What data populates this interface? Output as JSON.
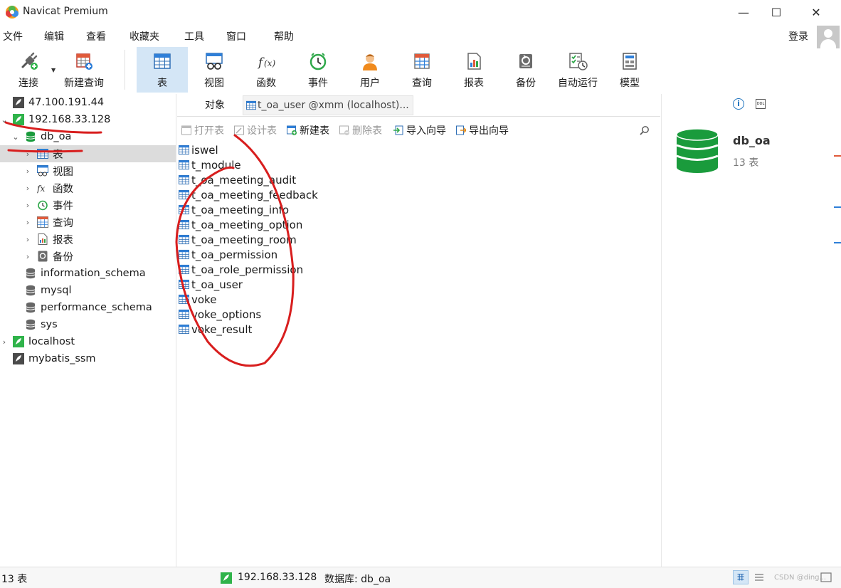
{
  "window": {
    "title": "Navicat Premium",
    "minimize_glyph": "—",
    "maximize_glyph": "☐",
    "close_glyph": "✕"
  },
  "menu": [
    "文件",
    "编辑",
    "查看",
    "收藏夹",
    "工具",
    "窗口",
    "帮助"
  ],
  "account": {
    "login_label": "登录",
    "avatar_icon": "user-avatar-icon"
  },
  "toolbar": [
    {
      "label": "连接",
      "icon": "plug-icon"
    },
    {
      "label": "新建查询",
      "icon": "new-query-icon"
    },
    {
      "label": "表",
      "icon": "table-icon",
      "active": true
    },
    {
      "label": "视图",
      "icon": "view-icon"
    },
    {
      "label": "函数",
      "icon": "function-icon"
    },
    {
      "label": "事件",
      "icon": "clock-icon"
    },
    {
      "label": "用户",
      "icon": "user-icon"
    },
    {
      "label": "查询",
      "icon": "query-icon"
    },
    {
      "label": "报表",
      "icon": "report-icon"
    },
    {
      "label": "备份",
      "icon": "backup-icon"
    },
    {
      "label": "自动运行",
      "icon": "automation-icon"
    },
    {
      "label": "模型",
      "icon": "model-icon"
    }
  ],
  "nav": {
    "items": [
      {
        "label": "47.100.191.44",
        "kind": "connection"
      },
      {
        "label": "192.168.33.128",
        "kind": "connection",
        "chevron": "⌄"
      },
      {
        "label": "db_oa",
        "kind": "database",
        "chevron": "⌄"
      },
      {
        "label": "表",
        "kind": "tables",
        "chevron": "›"
      },
      {
        "label": "视图",
        "kind": "views",
        "chevron": "›"
      },
      {
        "label": "函数",
        "kind": "functions",
        "chevron": "›"
      },
      {
        "label": "事件",
        "kind": "events",
        "chevron": "›"
      },
      {
        "label": "查询",
        "kind": "queries",
        "chevron": "›"
      },
      {
        "label": "报表",
        "kind": "reports",
        "chevron": "›"
      },
      {
        "label": "备份",
        "kind": "backups",
        "chevron": "›"
      },
      {
        "label": "information_schema",
        "kind": "database"
      },
      {
        "label": "mysql",
        "kind": "database"
      },
      {
        "label": "performance_schema",
        "kind": "database"
      },
      {
        "label": "sys",
        "kind": "database"
      },
      {
        "label": "localhost",
        "kind": "connection",
        "chevron": "›"
      },
      {
        "label": "mybatis_ssm",
        "kind": "connection"
      }
    ]
  },
  "tabs": {
    "objects_label": "对象",
    "query_tab_label": "t_oa_user @xmm (localhost)..."
  },
  "actions": [
    {
      "label": "打开表",
      "icon": "open-table-icon",
      "enabled": false
    },
    {
      "label": "设计表",
      "icon": "design-table-icon",
      "enabled": false
    },
    {
      "label": "新建表",
      "icon": "new-table-icon",
      "enabled": true
    },
    {
      "label": "删除表",
      "icon": "delete-table-icon",
      "enabled": false
    },
    {
      "label": "导入向导",
      "icon": "import-wizard-icon",
      "enabled": true
    },
    {
      "label": "导出向导",
      "icon": "export-wizard-icon",
      "enabled": true
    }
  ],
  "tables": [
    "iswel",
    "t_module",
    "t_oa_meeting_audit",
    "t_oa_meeting_feedback",
    "t_oa_meeting_info",
    "t_oa_meeting_option",
    "t_oa_meeting_room",
    "t_oa_permission",
    "t_oa_role_permission",
    "t_oa_user",
    "voke",
    "voke_options",
    "voke_result"
  ],
  "detail": {
    "db_name": "db_oa",
    "table_count": "13 表",
    "info_glyph": "i",
    "ddl_glyph": "DDL"
  },
  "status": {
    "count": "13 表",
    "connection": "192.168.33.128",
    "database": "数据库: db_oa"
  },
  "watermark": "CSDN @ding...",
  "colors": {
    "accent": "#1e73be",
    "active_tool": "#d4e6f6",
    "db_green": "#1a9b3c",
    "annotation": "#d81e1e",
    "connection_green": "#2fb34a"
  }
}
